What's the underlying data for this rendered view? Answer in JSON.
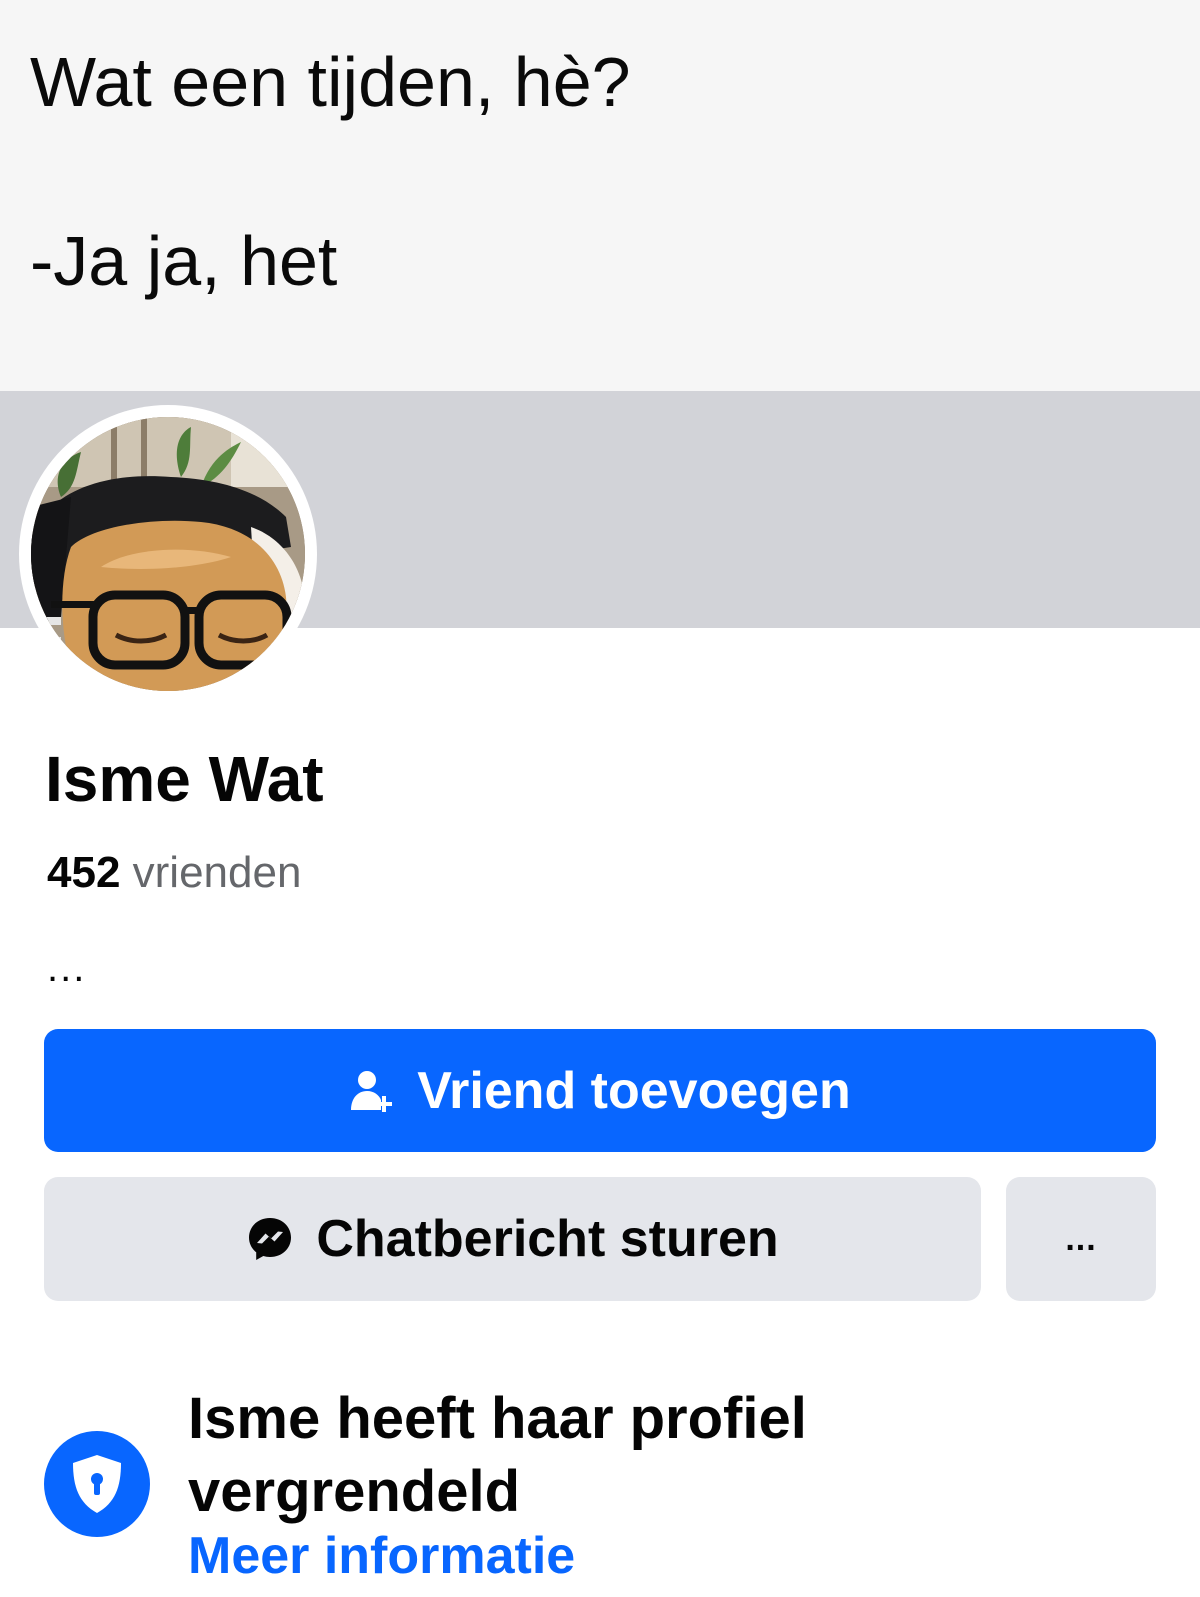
{
  "caption": {
    "line1": "Wat een tijden, hè?",
    "line2": "-Ja ja, het"
  },
  "profile": {
    "name": "Isme Wat",
    "friends_count": "452",
    "friends_label": "vrienden",
    "bio": "..."
  },
  "actions": {
    "add_friend_label": "Vriend toevoegen",
    "add_friend_icon": "add-friend-icon",
    "message_label": "Chatbericht sturen",
    "message_icon": "messenger-icon",
    "more_label": "..."
  },
  "lock_notice": {
    "title": "Isme heeft haar profiel vergrendeld",
    "link": "Meer informatie",
    "icon": "shield-lock-icon"
  },
  "colors": {
    "accent": "#0866ff",
    "cover": "#d2d3d8",
    "secondary_button": "#e4e6eb",
    "muted_text": "#65676b"
  }
}
